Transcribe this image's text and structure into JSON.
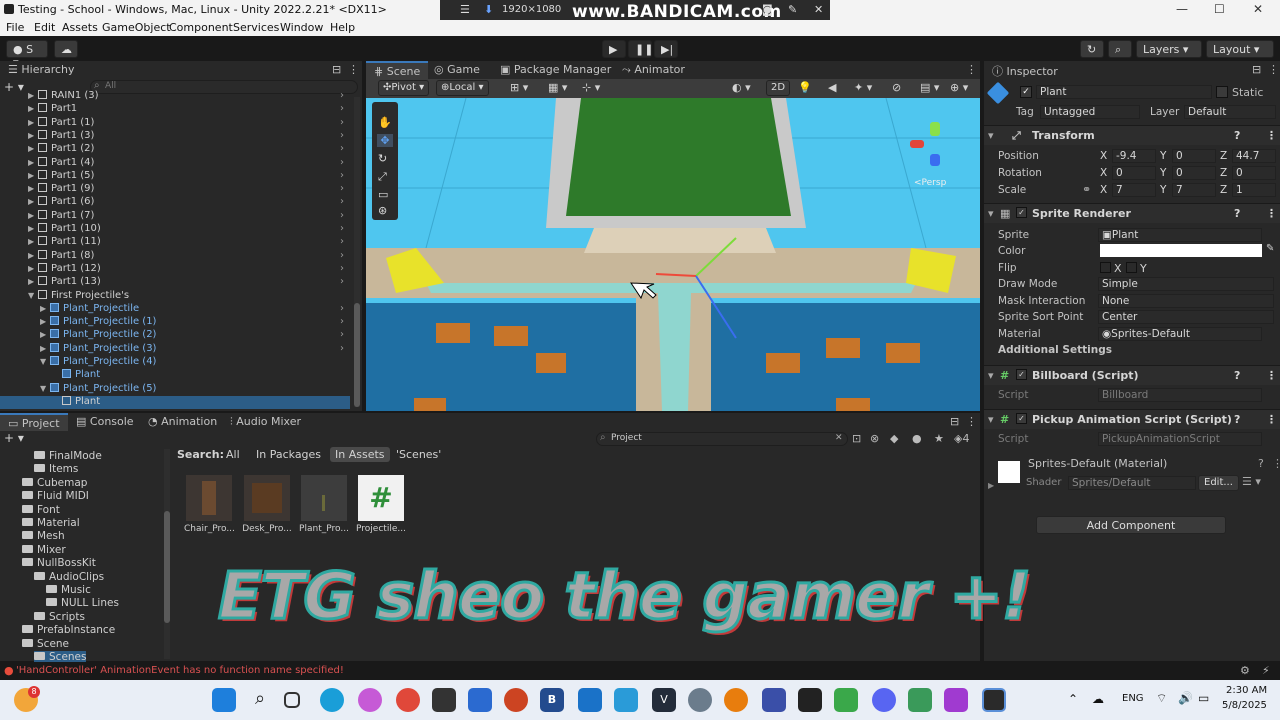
{
  "window": {
    "title": "Testing - School - Windows, Mac, Linux - Unity 2022.2.21* <DX11>"
  },
  "bandicam": {
    "logo": "www.BANDICAM.com",
    "resolution": "1920×1080"
  },
  "menu": [
    "File",
    "Edit",
    "Assets",
    "GameObject",
    "Component",
    "Services",
    "Window",
    "Help"
  ],
  "toolbar": {
    "account_label": "S",
    "layers_label": "Layers",
    "layout_label": "Layout"
  },
  "hierarchy": {
    "title": "Hierarchy",
    "search_placeholder": "All",
    "items": [
      {
        "label": "RAIN1 (3)",
        "depth": 1,
        "arrow": "▶",
        "blue": false
      },
      {
        "label": "Part1",
        "depth": 1,
        "arrow": "▶",
        "blue": false
      },
      {
        "label": "Part1 (1)",
        "depth": 1,
        "arrow": "▶",
        "blue": false
      },
      {
        "label": "Part1 (3)",
        "depth": 1,
        "arrow": "▶",
        "blue": false
      },
      {
        "label": "Part1 (2)",
        "depth": 1,
        "arrow": "▶",
        "blue": false
      },
      {
        "label": "Part1 (4)",
        "depth": 1,
        "arrow": "▶",
        "blue": false
      },
      {
        "label": "Part1 (5)",
        "depth": 1,
        "arrow": "▶",
        "blue": false
      },
      {
        "label": "Part1 (9)",
        "depth": 1,
        "arrow": "▶",
        "blue": false
      },
      {
        "label": "Part1 (6)",
        "depth": 1,
        "arrow": "▶",
        "blue": false
      },
      {
        "label": "Part1 (7)",
        "depth": 1,
        "arrow": "▶",
        "blue": false
      },
      {
        "label": "Part1 (10)",
        "depth": 1,
        "arrow": "▶",
        "blue": false
      },
      {
        "label": "Part1 (11)",
        "depth": 1,
        "arrow": "▶",
        "blue": false
      },
      {
        "label": "Part1 (8)",
        "depth": 1,
        "arrow": "▶",
        "blue": false
      },
      {
        "label": "Part1 (12)",
        "depth": 1,
        "arrow": "▶",
        "blue": false
      },
      {
        "label": "Part1 (13)",
        "depth": 1,
        "arrow": "▶",
        "blue": false
      },
      {
        "label": "First Projectile's",
        "depth": 1,
        "arrow": "▼",
        "blue": false
      },
      {
        "label": "Plant_Projectile",
        "depth": 2,
        "arrow": "▶",
        "blue": true
      },
      {
        "label": "Plant_Projectile (1)",
        "depth": 2,
        "arrow": "▶",
        "blue": true
      },
      {
        "label": "Plant_Projectile (2)",
        "depth": 2,
        "arrow": "▶",
        "blue": true
      },
      {
        "label": "Plant_Projectile (3)",
        "depth": 2,
        "arrow": "▶",
        "blue": true
      },
      {
        "label": "Plant_Projectile (4)",
        "depth": 2,
        "arrow": "▼",
        "blue": true
      },
      {
        "label": "Plant",
        "depth": 3,
        "arrow": "",
        "blue": true
      },
      {
        "label": "Plant_Projectile (5)",
        "depth": 2,
        "arrow": "▼",
        "blue": true
      },
      {
        "label": "Plant",
        "depth": 3,
        "arrow": "",
        "blue": false
      }
    ]
  },
  "scene": {
    "tabs": [
      "Scene",
      "Game",
      "Package Manager",
      "Animator"
    ],
    "pivot": "Pivot",
    "local": "Local",
    "mode_2d": "2D",
    "gizmo_label": "<Persp"
  },
  "inspector": {
    "title": "Inspector",
    "object_name": "Plant",
    "static_label": "Static",
    "tag_label": "Tag",
    "tag_value": "Untagged",
    "layer_label": "Layer",
    "layer_value": "Default",
    "transform": {
      "title": "Transform",
      "position_label": "Position",
      "pos": [
        "-9.4",
        "0",
        "44.7"
      ],
      "rotation_label": "Rotation",
      "rot": [
        "0",
        "0",
        "0"
      ],
      "scale_label": "Scale",
      "scale": [
        "7",
        "7",
        "1"
      ],
      "axes": [
        "X",
        "Y",
        "Z"
      ]
    },
    "sprite_renderer": {
      "title": "Sprite Renderer",
      "sprite_label": "Sprite",
      "sprite_value": "Plant",
      "color_label": "Color",
      "flip_label": "Flip",
      "flip_x": "X",
      "flip_y": "Y",
      "draw_mode_label": "Draw Mode",
      "draw_mode_value": "Simple",
      "mask_label": "Mask Interaction",
      "mask_value": "None",
      "sort_label": "Sprite Sort Point",
      "sort_value": "Center",
      "material_label": "Material",
      "material_value": "Sprites-Default",
      "additional": "Additional Settings"
    },
    "billboard": {
      "title": "Billboard (Script)",
      "script_label": "Script",
      "script_value": "Billboard"
    },
    "pickup": {
      "title": "Pickup Animation Script (Script)",
      "script_label": "Script",
      "script_value": "PickupAnimationScript"
    },
    "material": {
      "title": "Sprites-Default (Material)",
      "shader_label": "Shader",
      "shader_value": "Sprites/Default",
      "edit": "Edit..."
    },
    "add_component": "Add Component"
  },
  "project": {
    "tabs": [
      "Project",
      "Console",
      "Animation",
      "Audio Mixer"
    ],
    "search_value": "Project",
    "filter_label": "Search:",
    "filters": [
      "All",
      "In Packages",
      "In Assets",
      "'Scenes'"
    ],
    "hidden_count": "4",
    "tree": [
      {
        "label": "FinalMode",
        "depth": 3
      },
      {
        "label": "Items",
        "depth": 3
      },
      {
        "label": "Cubemap",
        "depth": 2
      },
      {
        "label": "Fluid MIDI",
        "depth": 2
      },
      {
        "label": "Font",
        "depth": 2
      },
      {
        "label": "Material",
        "depth": 2
      },
      {
        "label": "Mesh",
        "depth": 2
      },
      {
        "label": "Mixer",
        "depth": 2
      },
      {
        "label": "NullBossKit",
        "depth": 2
      },
      {
        "label": "AudioClips",
        "depth": 3
      },
      {
        "label": "Music",
        "depth": 4
      },
      {
        "label": "NULL Lines",
        "depth": 4
      },
      {
        "label": "Scripts",
        "depth": 3
      },
      {
        "label": "PrefabInstance",
        "depth": 2
      },
      {
        "label": "Scene",
        "depth": 2
      },
      {
        "label": "Scenes",
        "depth": 3
      }
    ],
    "assets": [
      {
        "label": "Chair_Pro..."
      },
      {
        "label": "Desk_Pro..."
      },
      {
        "label": "Plant_Pro..."
      },
      {
        "label": "Projectile..."
      }
    ]
  },
  "status": {
    "message": "'HandController' AnimationEvent has no function name specified!"
  },
  "watermark": "ETG sheo the gamer +!",
  "taskbar": {
    "lang": "ENG",
    "time": "2:30 AM",
    "date": "5/8/2025",
    "badge": "8"
  }
}
